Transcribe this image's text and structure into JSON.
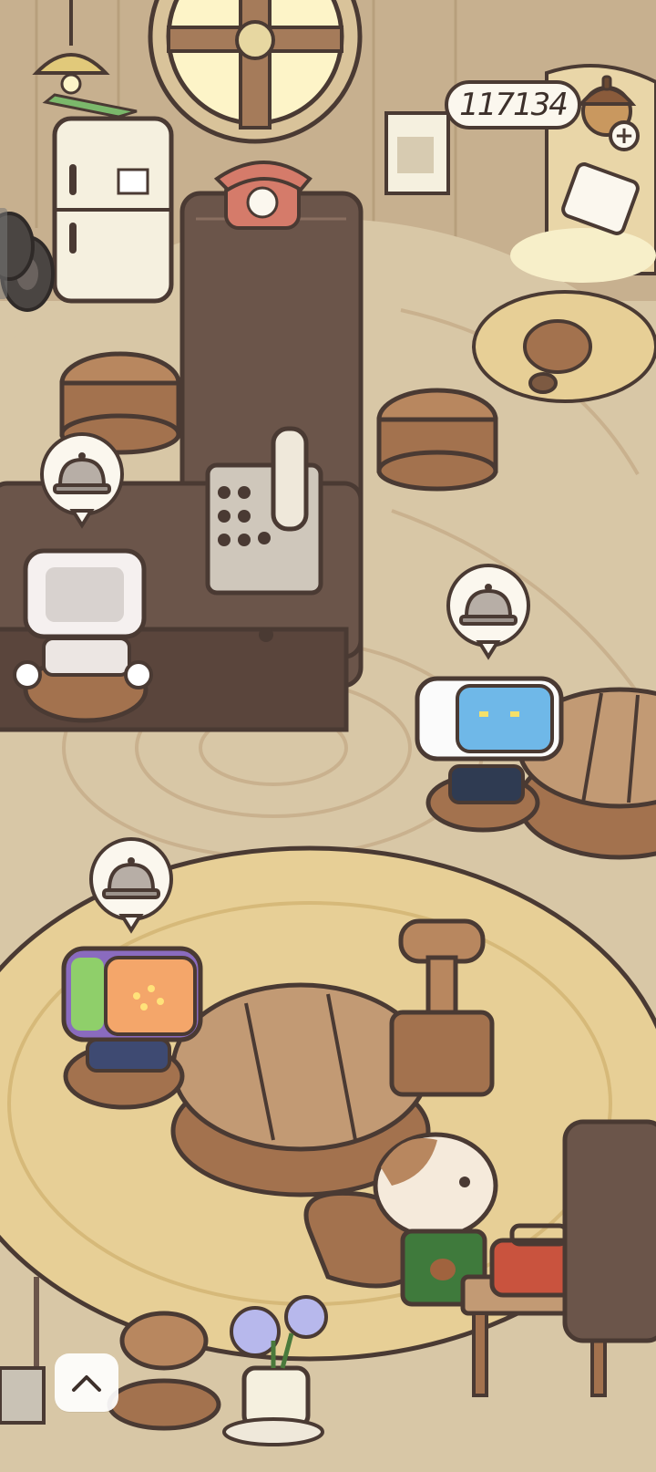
{
  "hud": {
    "coin_count": "117134",
    "plus_label": "+",
    "currency_icon": "acorn-icon"
  },
  "controls": {
    "collapse_icon": "chevron-up-icon"
  },
  "colors": {
    "floor": "#d8c7a6",
    "wood_dark": "#6b554a",
    "wood_light": "#b89876",
    "outline": "#4a3a33",
    "rug": "#e7cf96"
  }
}
